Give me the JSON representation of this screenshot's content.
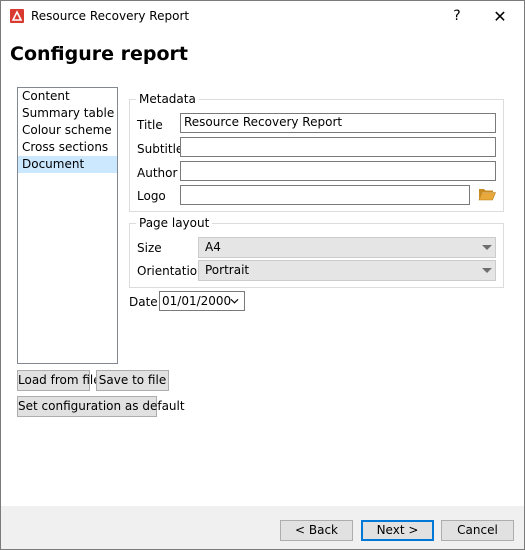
{
  "window": {
    "title": "Resource Recovery Report",
    "help_label": "?",
    "close_label": "✕",
    "app_icon": "report-logo-icon"
  },
  "heading": "Configure report",
  "nav": {
    "items": [
      {
        "label": "Content"
      },
      {
        "label": "Summary table"
      },
      {
        "label": "Colour scheme"
      },
      {
        "label": "Cross sections"
      },
      {
        "label": "Document"
      }
    ],
    "selected": "Document"
  },
  "metadata": {
    "title": "Metadata",
    "title_label": "Title",
    "title_value": "Resource Recovery Report",
    "subtitle_label": "Subtitle",
    "subtitle_value": "",
    "author_label": "Author",
    "author_value": "",
    "logo_label": "Logo",
    "logo_value": "",
    "logo_browse_icon": "folder-open-icon"
  },
  "page_layout": {
    "title": "Page layout",
    "size_label": "Size",
    "size_value": "A4",
    "orientation_label": "Orientation",
    "orientation_value": "Portrait"
  },
  "date": {
    "label": "Date",
    "value": "01/01/2000"
  },
  "actions": {
    "load": "Load from file",
    "save": "Save to file",
    "set_default": "Set configuration as default"
  },
  "footer": {
    "back": "< Back",
    "next": "Next >",
    "cancel": "Cancel"
  },
  "colors": {
    "selection": "#cce8ff",
    "accent": "#0078d7",
    "icon_red": "#d93b30",
    "folder": "#e8a93a"
  }
}
